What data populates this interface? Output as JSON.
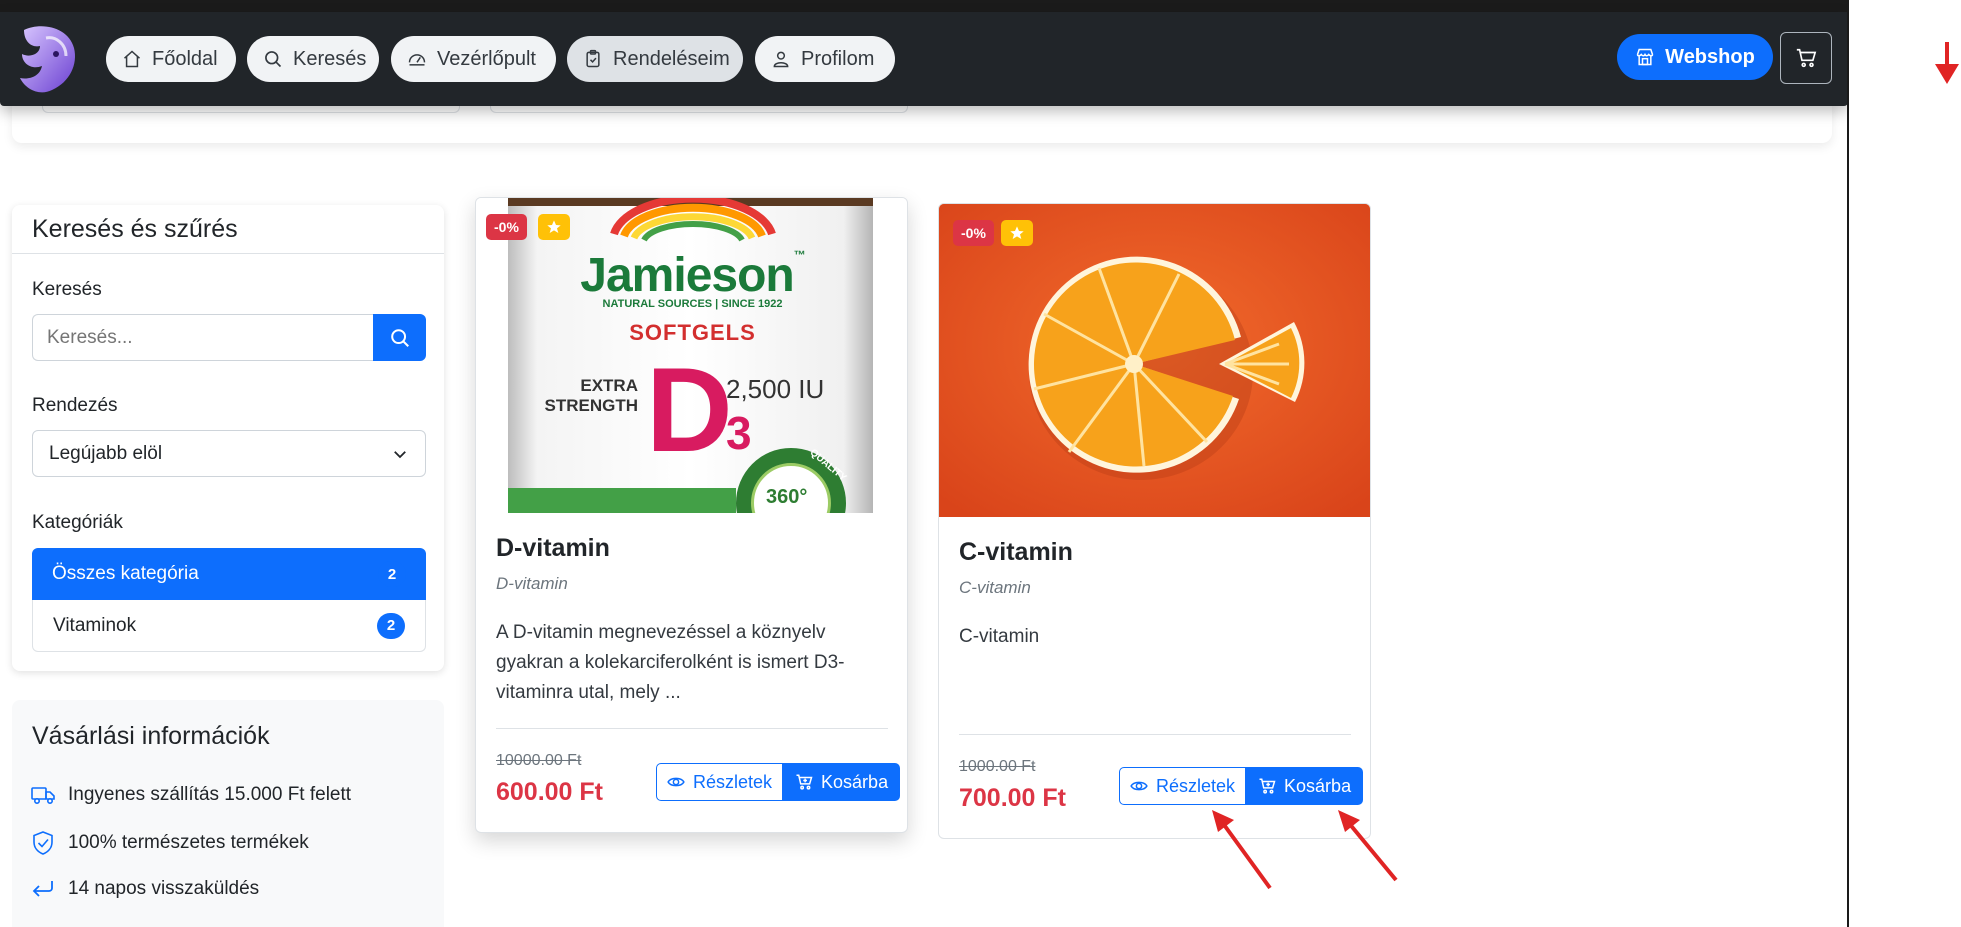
{
  "nav": {
    "items": [
      {
        "label": "Főoldal",
        "icon": "home-icon"
      },
      {
        "label": "Keresés",
        "icon": "search-icon"
      },
      {
        "label": "Vezérlőpult",
        "icon": "dashboard-icon"
      },
      {
        "label": "Rendeléseim",
        "icon": "clipboard-icon"
      },
      {
        "label": "Profilom",
        "icon": "user-icon"
      }
    ],
    "webshop_label": "Webshop"
  },
  "filter": {
    "title": "Keresés és szűrés",
    "search_label": "Keresés",
    "search_placeholder": "Keresés...",
    "sort_label": "Rendezés",
    "sort_value": "Legújabb elöl",
    "categories_label": "Kategóriák",
    "categories": [
      {
        "label": "Összes kategória",
        "count": "2"
      },
      {
        "label": "Vitaminok",
        "count": "2"
      }
    ]
  },
  "info": {
    "title": "Vásárlási információk",
    "rows": [
      {
        "text": "Ingyenes szállítás 15.000 Ft felett",
        "icon": "truck-icon"
      },
      {
        "text": "100% természetes termékek",
        "icon": "shield-check-icon"
      },
      {
        "text": "14 napos visszaküldés",
        "icon": "return-arrow-icon"
      }
    ]
  },
  "products": [
    {
      "name": "D-vitamin",
      "subtitle": "D-vitamin",
      "description": "A D-vitamin megnevezéssel a köznyelv gyakran a kolekarciferolként is ismert D3-vitaminra utal, mely ...",
      "old_price": "10000.00 Ft",
      "price": "600.00 Ft",
      "discount": "-0%",
      "image_brand": "Jamieson",
      "image_tm": "™",
      "image_tagline": "NATURAL SOURCES | SINCE 1922",
      "image_softgels": "SOFTGELS",
      "image_extra": "EXTRA",
      "image_strength": "STRENGTH",
      "image_d": "D",
      "image_sub3": "3",
      "image_iu": "2,500 IU",
      "image_360": "360°",
      "image_quality": "QUALITY",
      "details_label": "Részletek",
      "cart_label": "Kosárba"
    },
    {
      "name": "C-vitamin",
      "subtitle": "C-vitamin",
      "description": "C-vitamin",
      "old_price": "1000.00 Ft",
      "price": "700.00 Ft",
      "discount": "-0%",
      "details_label": "Részletek",
      "cart_label": "Kosárba"
    }
  ],
  "colors": {
    "primary": "#0d6efd",
    "danger": "#dc3545",
    "warning": "#ffc107",
    "navbar": "#212529",
    "annotation": "#e02424"
  }
}
